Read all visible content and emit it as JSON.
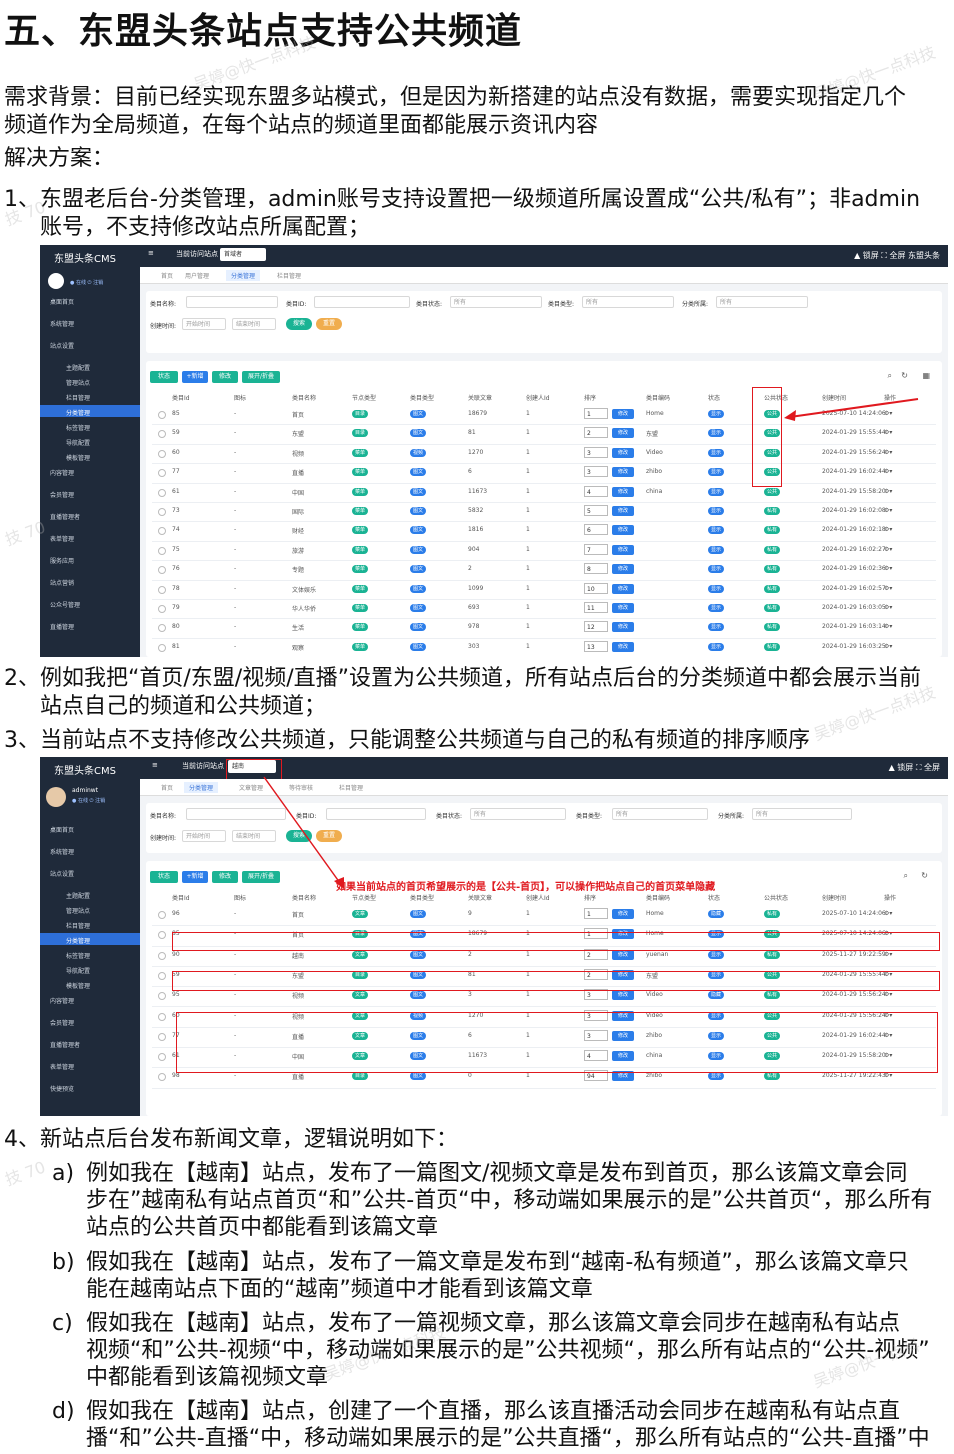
{
  "title": "五、东盟头条站点支持公共频道",
  "background_lines": [
    "需求背景：目前已经实现东盟多站模式，但是因为新搭建的站点没有数据，需要实现指定几个",
    "频道作为全局频道，在每个站点的频道里面都能展示资讯内容"
  ],
  "solution_label": "解决方案：",
  "points": [
    {
      "num": "1、",
      "lines": [
        "东盟老后台-分类管理，admin账号支持设置把一级频道所属设置成“公共/私有”；非admin",
        "账号，不支持修改站点所属配置；"
      ]
    },
    {
      "num": "2、",
      "lines": [
        "例如我把“首页/东盟/视频/直播”设置为公共频道，所有站点后台的分类频道中都会展示当前",
        "站点自己的频道和公共频道；"
      ]
    },
    {
      "num": "3、",
      "lines": [
        "当前站点不支持修改公共频道，只能调整公共频道与自己的私有频道的排序顺序"
      ]
    },
    {
      "num": "4、",
      "lines": [
        "新站点后台发布新闻文章，逻辑说明如下："
      ]
    }
  ],
  "subpoints": [
    {
      "num": "a)",
      "lines": [
        "例如我在【越南】站点，发布了一篇图文/视频文章是发布到首页，那么该篇文章会同",
        "步在”越南私有站点首页“和”公共-首页“中，移动端如果展示的是”公共首页“，那么所有",
        "站点的公共首页中都能看到该篇文章"
      ]
    },
    {
      "num": "b)",
      "lines": [
        "假如我在【越南】站点，发布了一篇文章是发布到“越南-私有频道”，那么该篇文章只",
        "能在越南站点下面的“越南”频道中才能看到该篇文章"
      ]
    },
    {
      "num": "c)",
      "lines": [
        "假如我在【越南】站点，发布了一篇视频文章，那么该篇文章会同步在越南私有站点",
        "视频“和”公共-视频“中，移动端如果展示的是”公共视频“，那么所有站点的“公共-视频”",
        "中都能看到该篇视频文章"
      ]
    },
    {
      "num": "d)",
      "lines": [
        "假如我在【越南】站点，创建了一个直播，那么该直播活动会同步在越南私有站点直",
        "播“和”公共-直播“中，移动端如果展示的是”公共直播“，那么所有站点的“公共-直播”中"
      ]
    }
  ],
  "shot1": {
    "logo": "东盟头条CMS",
    "top_mid": "当前访问站点",
    "site_select": "首域者",
    "top_right": "▲ 锁屏   ⛶ 全屏   东盟头条",
    "user": "● 在线  ⏻ 注销",
    "sidebar": [
      "桌面首页",
      "系统管理",
      "站点设置",
      "主题配置",
      "管理站点",
      "栏目管理",
      "分类管理",
      "标签管理",
      "导航配置",
      "模板管理",
      "内容管理",
      "会员管理",
      "直播管理者",
      "表单管理",
      "服务应用",
      "站点营销",
      "公众号管理",
      "直播管理"
    ],
    "tabs": [
      "首页",
      "用户管理",
      "分类管理",
      "栏目管理"
    ],
    "filters": [
      "类目名称:",
      "类目ID:",
      "类目状态:",
      "类目类型:",
      "分类所属:",
      "创建时间:"
    ],
    "filter_values": [
      "所有",
      "所有",
      "所有"
    ],
    "date_placeholders": [
      "开始时间",
      "结束时间"
    ],
    "buttons": [
      "搜索",
      "重置"
    ],
    "toolbar": [
      "状态",
      "+新增",
      "修改",
      "展开/折叠"
    ],
    "headers": [
      "类目Id",
      "图标",
      "类目名称",
      "节点类型",
      "类目类型",
      "关联文章",
      "创建人Id",
      "排序",
      "类目编码",
      "状态",
      "公共状态",
      "创建时间",
      "操作"
    ],
    "rows": [
      [
        "85",
        "-",
        "首页",
        "目录",
        "图文",
        "18679",
        "1",
        "1",
        "Home",
        "显示",
        "公共",
        "2025-07-10 14:24:06"
      ],
      [
        "59",
        "-",
        "东盟",
        "目录",
        "图文",
        "81",
        "1",
        "2",
        "东盟",
        "显示",
        "公共",
        "2024-01-29 15:55:44"
      ],
      [
        "60",
        "-",
        "视频",
        "菜单",
        "视频",
        "1270",
        "1",
        "3",
        "Video",
        "显示",
        "公共",
        "2024-01-29 15:56:24"
      ],
      [
        "77",
        "-",
        "直播",
        "菜单",
        "图文",
        "6",
        "1",
        "3",
        "zhibo",
        "显示",
        "公共",
        "2024-01-29 16:02:44"
      ],
      [
        "61",
        "-",
        "中国",
        "菜单",
        "图文",
        "11673",
        "1",
        "4",
        "china",
        "显示",
        "公共",
        "2024-01-29 15:58:20"
      ],
      [
        "73",
        "-",
        "国际",
        "菜单",
        "图文",
        "5832",
        "1",
        "5",
        "",
        "显示",
        "私有",
        "2024-01-29 16:02:08"
      ],
      [
        "74",
        "-",
        "财经",
        "菜单",
        "图文",
        "1816",
        "1",
        "6",
        "",
        "显示",
        "私有",
        "2024-01-29 16:02:18"
      ],
      [
        "75",
        "-",
        "旅游",
        "菜单",
        "图文",
        "904",
        "1",
        "7",
        "",
        "显示",
        "私有",
        "2024-01-29 16:02:27"
      ],
      [
        "76",
        "-",
        "专题",
        "菜单",
        "图文",
        "2",
        "1",
        "8",
        "",
        "显示",
        "私有",
        "2024-01-29 16:02:36"
      ],
      [
        "78",
        "-",
        "文体娱乐",
        "菜单",
        "图文",
        "1099",
        "1",
        "10",
        "",
        "显示",
        "私有",
        "2024-01-29 16:02:57"
      ],
      [
        "79",
        "-",
        "华人华侨",
        "菜单",
        "图文",
        "693",
        "1",
        "11",
        "",
        "显示",
        "私有",
        "2024-01-29 16:03:05"
      ],
      [
        "80",
        "-",
        "生活",
        "菜单",
        "图文",
        "978",
        "1",
        "12",
        "",
        "显示",
        "私有",
        "2024-01-29 16:03:14"
      ],
      [
        "81",
        "-",
        "观察",
        "菜单",
        "图文",
        "303",
        "1",
        "13",
        "",
        "显示",
        "私有",
        "2024-01-29 16:03:25"
      ],
      [
        "82",
        "-",
        "English",
        "菜单",
        "图文",
        "1142",
        "1",
        "14",
        "",
        "显示",
        "私有",
        "2024-03-12 16:42:03"
      ]
    ],
    "edit_label": "修改"
  },
  "shot2": {
    "logo": "东盟头条CMS",
    "top_mid": "当前访问站点",
    "site_select": "越南",
    "top_right": "▲ 锁屏   ⛶ 全屏",
    "user_name": "adminwt",
    "user": "● 在线  ⏻ 注销",
    "sidebar": [
      "桌面首页",
      "系统管理",
      "站点设置",
      "主题配置",
      "管理站点",
      "栏目管理",
      "分类管理",
      "标签管理",
      "导航配置",
      "模板管理",
      "内容管理",
      "会员管理",
      "直播管理者",
      "表单管理",
      "快捷预览"
    ],
    "tabs": [
      "首页",
      "分类管理",
      "文章管理",
      "等待审核",
      "栏目管理"
    ],
    "filters": [
      "类目名称:",
      "类目ID:",
      "类目状态:",
      "类目类型:",
      "分类所属:",
      "创建时间:"
    ],
    "filter_values": [
      "所有",
      "所有",
      "所有"
    ],
    "date_placeholders": [
      "开始时间",
      "结束时间"
    ],
    "buttons": [
      "搜索",
      "重置"
    ],
    "toolbar": [
      "状态",
      "+新增",
      "修改",
      "展开/折叠"
    ],
    "annotation": "如果当前站点的首页希望展示的是【公共-首页】，可以操作把站点自己的首页菜单隐藏",
    "headers": [
      "类目Id",
      "图标",
      "类目名称",
      "节点类型",
      "类目类型",
      "关联文章",
      "创建人Id",
      "排序",
      "类目编码",
      "状态",
      "公共状态",
      "创建时间",
      "操作"
    ],
    "rows": [
      [
        "96",
        "-",
        "首页",
        "文章",
        "图文",
        "9",
        "1",
        "1",
        "Home",
        "隐藏",
        "私有",
        "2025-07-10 14:24:06"
      ],
      [
        "85",
        "-",
        "首页",
        "目录",
        "图文",
        "18679",
        "1",
        "1",
        "Home",
        "显示",
        "公共",
        "2025-07-10 14:24:06"
      ],
      [
        "90",
        "-",
        "越南",
        "文章",
        "图文",
        "2",
        "1",
        "2",
        "yuenan",
        "显示",
        "私有",
        "2025-11-27 19:22:59"
      ],
      [
        "59",
        "-",
        "东盟",
        "目录",
        "图文",
        "81",
        "1",
        "2",
        "东盟",
        "显示",
        "公共",
        "2024-01-29 15:55:44"
      ],
      [
        "95",
        "-",
        "视频",
        "文章",
        "图文",
        "3",
        "1",
        "3",
        "Video",
        "隐藏",
        "私有",
        "2024-01-29 15:56:24"
      ],
      [
        "60",
        "-",
        "视频",
        "文章",
        "视频",
        "1270",
        "1",
        "3",
        "Video",
        "显示",
        "公共",
        "2024-01-29 15:56:24"
      ],
      [
        "77",
        "-",
        "直播",
        "文章",
        "图文",
        "6",
        "1",
        "3",
        "zhibo",
        "显示",
        "公共",
        "2024-01-29 16:02:44"
      ],
      [
        "61",
        "-",
        "中国",
        "文章",
        "图文",
        "11673",
        "1",
        "4",
        "china",
        "显示",
        "公共",
        "2024-01-29 15:58:20"
      ],
      [
        "98",
        "-",
        "直播",
        "目录",
        "图文",
        "0",
        "1",
        "94",
        "zhibo",
        "显示",
        "私有",
        "2025-11-27 19:22:43"
      ]
    ],
    "edit_label": "修改"
  },
  "watermarks": [
    "吴婷@快一点科技",
    "技 70",
    "吴婷@快一点科技",
    "技 70",
    "吴婷@快一点科技",
    "技 70",
    "吴婷@快一点科技",
    "吴婷@快一点科"
  ]
}
